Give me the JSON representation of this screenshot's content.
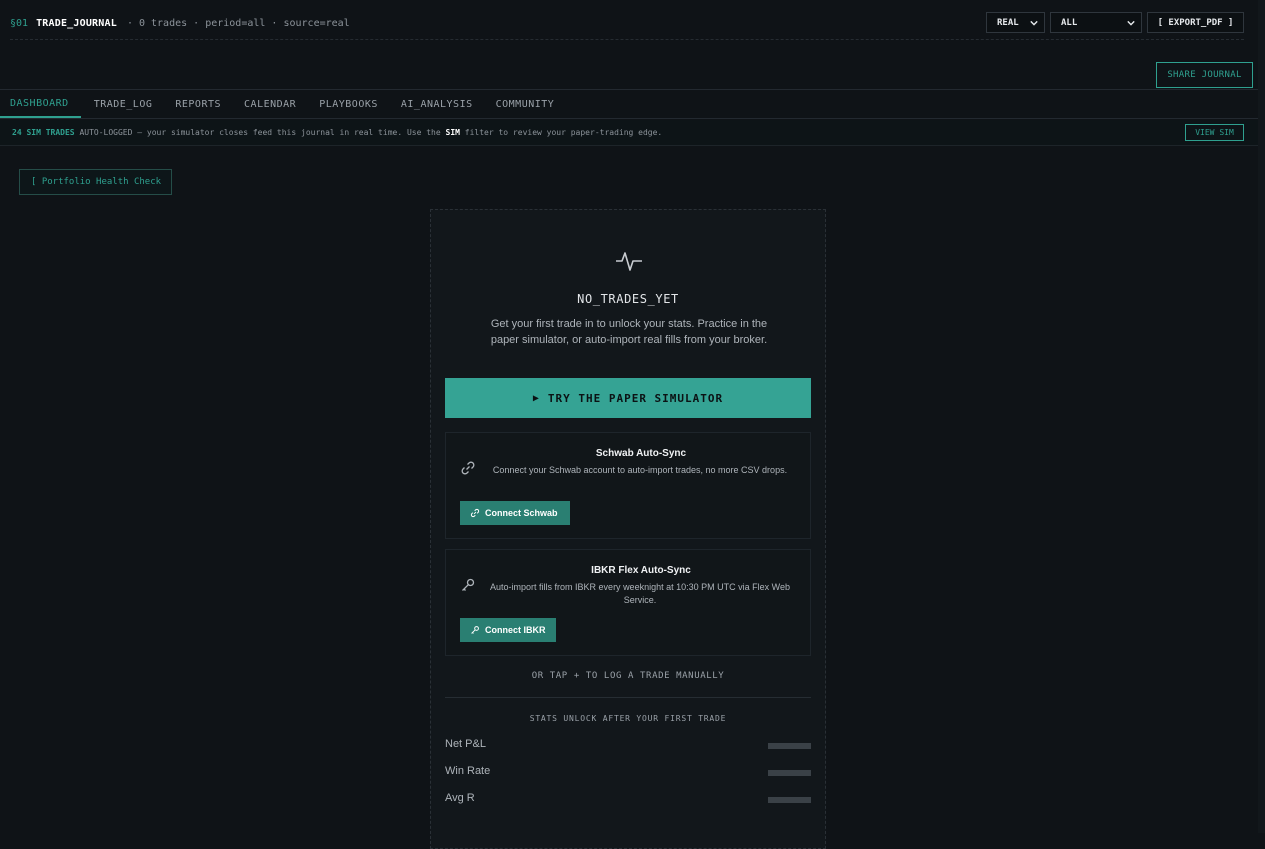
{
  "header": {
    "section": "§01",
    "title": "TRADE_JOURNAL",
    "meta": "· 0 trades · period=all · source=real",
    "source_select": "REAL",
    "period_select": "ALL",
    "export_label": "[ EXPORT_PDF ]",
    "share_label": "SHARE JOURNAL"
  },
  "tabs": [
    {
      "label": "DASHBOARD",
      "active": true
    },
    {
      "label": "TRADE_LOG"
    },
    {
      "label": "REPORTS"
    },
    {
      "label": "CALENDAR"
    },
    {
      "label": "PLAYBOOKS"
    },
    {
      "label": "AI_ANALYSIS"
    },
    {
      "label": "COMMUNITY"
    }
  ],
  "banner": {
    "highlight": "24 SIM TRADES",
    "text1": " AUTO-LOGGED — your simulator closes feed this journal in real time. Use the ",
    "bold": "SIM",
    "text2": " filter to review your paper-trading edge.",
    "view_label": "VIEW SIM"
  },
  "health_check": "[ Portfolio Health Check",
  "empty": {
    "icon": "pulse-icon",
    "title": "NO_TRADES_YET",
    "description": "Get your first trade in to unlock your stats. Practice in the paper simulator, or auto-import real fills from your broker.",
    "try_label": "TRY THE PAPER SIMULATOR",
    "manual": "OR TAP + TO LOG A TRADE MANUALLY",
    "unlock": "STATS UNLOCK AFTER YOUR FIRST TRADE"
  },
  "integrations": {
    "schwab": {
      "title": "Schwab Auto-Sync",
      "desc": "Connect your Schwab account to auto-import trades, no more CSV drops.",
      "button": "Connect Schwab",
      "icon": "link-icon"
    },
    "ibkr": {
      "title": "IBKR Flex Auto-Sync",
      "desc": "Auto-import fills from IBKR every weeknight at 10:30 PM UTC via Flex Web Service.",
      "button": "Connect IBKR",
      "icon": "key-icon"
    }
  },
  "stats": [
    {
      "label": "Net P&L"
    },
    {
      "label": "Win Rate"
    },
    {
      "label": "Avg R"
    }
  ],
  "colors": {
    "accent": "#35a394",
    "background": "#0f1317"
  }
}
